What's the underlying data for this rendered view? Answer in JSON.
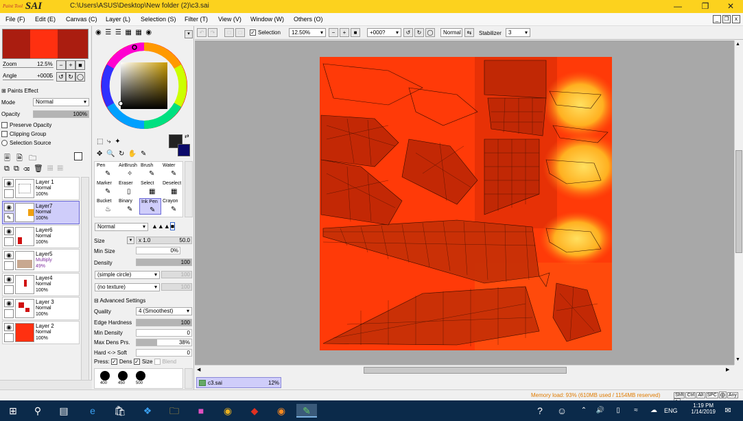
{
  "app": {
    "logo_text": "SAI",
    "logo_sub": "Paint Tool",
    "title": "C:\\Users\\ASUS\\Desktop\\New folder (2)\\c3.sai"
  },
  "menu": [
    "File (F)",
    "Edit (E)",
    "Canvas (C)",
    "Layer (L)",
    "Selection (S)",
    "Filter (T)",
    "View (V)",
    "Window (W)",
    "Others (O)"
  ],
  "navigator": {
    "zoom_label": "Zoom",
    "zoom_value": "12.5%",
    "angle_label": "Angle",
    "angle_value": "+000Б"
  },
  "paint_effects": {
    "header": "Paints Effect",
    "mode_label": "Mode",
    "mode_value": "Normal",
    "opacity_label": "Opacity",
    "opacity_value": "100%",
    "preserve_opacity": "Preserve Opacity",
    "clipping_group": "Clipping Group",
    "selection_source": "Selection Source"
  },
  "layers": [
    {
      "name": "Layer 1",
      "mode": "Normal",
      "opacity": "100%",
      "selected": false
    },
    {
      "name": "Layer7",
      "mode": "Normal",
      "opacity": "100%",
      "selected": true
    },
    {
      "name": "Layer6",
      "mode": "Normal",
      "opacity": "100%",
      "selected": false
    },
    {
      "name": "Layer5",
      "mode": "Multiply",
      "opacity": "49%",
      "selected": false
    },
    {
      "name": "Layer4",
      "mode": "Normal",
      "opacity": "100%",
      "selected": false
    },
    {
      "name": "Layer 3",
      "mode": "Normal",
      "opacity": "100%",
      "selected": false
    },
    {
      "name": "Layer 2",
      "mode": "Normal",
      "opacity": "100%",
      "selected": false
    }
  ],
  "tools": [
    {
      "label": "Pen",
      "icon": "pen-icon"
    },
    {
      "label": "AirBrush",
      "icon": "airbrush-icon"
    },
    {
      "label": "Brush",
      "icon": "brush-icon"
    },
    {
      "label": "Water",
      "icon": "water-icon"
    },
    {
      "label": "Marker",
      "icon": "marker-icon"
    },
    {
      "label": "Eraser",
      "icon": "eraser-icon"
    },
    {
      "label": "Select",
      "icon": "select-icon"
    },
    {
      "label": "Deselect",
      "icon": "deselect-icon"
    },
    {
      "label": "Bucket",
      "icon": "bucket-icon"
    },
    {
      "label": "Binary",
      "icon": "binary-icon"
    },
    {
      "label": "Ink Pen",
      "icon": "ink-pen-icon"
    },
    {
      "label": "Crayon",
      "icon": "crayon-icon"
    }
  ],
  "brush": {
    "blend_mode": "Normal",
    "size_label": "Size",
    "size_mult": "x 1.0",
    "size_value": "50.0",
    "min_size_label": "Min Size",
    "min_size_value": "0%",
    "density_label": "Density",
    "density_value": "100",
    "shape": "(simple circle)",
    "shape_value": "100",
    "texture": "(no texture)",
    "texture_value": "100",
    "advanced_label": "Advanced Settings",
    "quality_label": "Quality",
    "quality_value": "4 (Smoothest)",
    "edge_hardness_label": "Edge Hardness",
    "edge_hardness_value": "100",
    "min_density_label": "Min Density",
    "min_density_value": "0",
    "max_dens_prs_label": "Max Dens Prs.",
    "max_dens_prs_value": "38%",
    "hard_soft_label": "Hard <-> Soft",
    "hard_soft_value": "0",
    "press_label": "Press:",
    "press_dens": "Dens",
    "press_size": "Size",
    "press_blend": "Blend",
    "presets": [
      "400",
      "450",
      "500"
    ]
  },
  "toolbar": {
    "selection_label": "Selection",
    "zoom_value": "12.50%",
    "angle_value": "+000?",
    "mode_value": "Normal",
    "stabilizer_label": "Stabilizer",
    "stabilizer_value": "3"
  },
  "file_tab": {
    "name": "c3.sai",
    "zoom": "12%"
  },
  "status": {
    "memory": "Memory load: 93% (610MB used / 1154MB reserved)",
    "keys": [
      "Shft",
      "Ctrl",
      "Alt",
      "SPC",
      "Any"
    ]
  },
  "taskbar": {
    "lang": "ENG",
    "time": "1:19 PM",
    "date": "1/14/2019"
  },
  "colors": {
    "titlebar": "#fcd21e",
    "canvas_bg": "#a8a8a8",
    "artwork": "#ff3300",
    "selection": "#cfcdfa",
    "taskbar": "#0b2a4a"
  }
}
